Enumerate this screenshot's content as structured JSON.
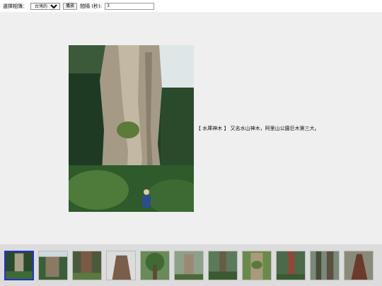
{
  "toolbar": {
    "album_label": "選擇相簿：",
    "album_selected": "台灣的巨木",
    "play_label": "播放",
    "interval_label": "間隔 (秒):",
    "interval_value": "3"
  },
  "viewer": {
    "caption": "【 水庫神木 】 又名水山神木，阿里山公園巨木第三大。"
  },
  "thumbnails": {
    "count": 11,
    "selected_index": 0
  }
}
